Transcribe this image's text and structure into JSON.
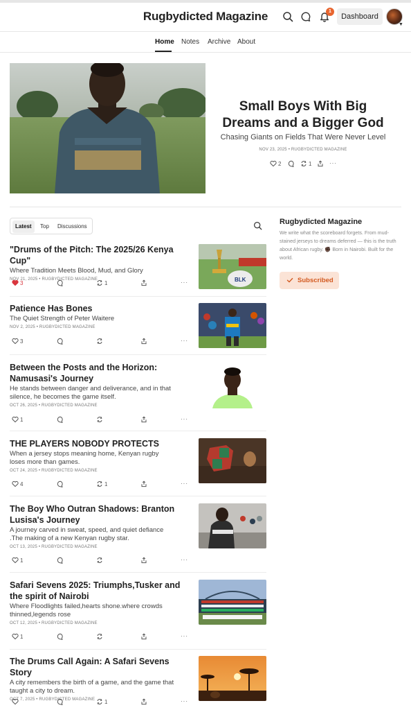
{
  "header": {
    "brand": "Rugbydicted Magazine",
    "notification_count": "1",
    "dashboard_label": "Dashboard",
    "icons": [
      "search-icon",
      "chat-icon",
      "bell-icon",
      "avatar",
      "chevron-down-icon"
    ]
  },
  "nav": {
    "items": [
      {
        "label": "Home",
        "active": true
      },
      {
        "label": "Notes",
        "active": false
      },
      {
        "label": "Archive",
        "active": false
      },
      {
        "label": "About",
        "active": false
      }
    ]
  },
  "hero": {
    "title": "Small Boys With Big Dreams and a Bigger God",
    "subtitle": "Chasing Giants on Fields That Were Never Level",
    "meta": "NOV 23, 2025 • RUGBYDICTED MAGAZINE",
    "likes": "2",
    "restacks": "1"
  },
  "feed": {
    "tabs": [
      {
        "label": "Latest",
        "active": true
      },
      {
        "label": "Top",
        "active": false
      },
      {
        "label": "Discussions",
        "active": false
      }
    ],
    "posts": [
      {
        "title": "\"Drums of the Pitch: The 2025/26 Kenya Cup\"",
        "subtitle": "Where Tradition Meets Blood, Mud, and Glory",
        "meta": "NOV 21, 2025 • RUGBYDICTED MAGAZINE",
        "likes": "3",
        "restacks": "1",
        "liked": true
      },
      {
        "title": "Patience Has Bones",
        "subtitle": "The Quiet Strength of Peter Waitere",
        "meta": "NOV 2, 2025 • RUGBYDICTED MAGAZINE",
        "likes": "3",
        "restacks": "",
        "liked": false
      },
      {
        "title": "Between the Posts and the Horizon: Namusasi's Journey",
        "subtitle": "He stands between danger and deliverance, and in that silence, he becomes the game itself.",
        "meta": "OCT 26, 2025 • RUGBYDICTED MAGAZINE",
        "likes": "1",
        "restacks": "",
        "liked": false
      },
      {
        "title": "THE PLAYERS NOBODY PROTECTS",
        "subtitle": "When a jersey stops meaning home, Kenyan rugby loses more than games.",
        "meta": "OCT 24, 2025 • RUGBYDICTED MAGAZINE",
        "likes": "4",
        "restacks": "1",
        "liked": false
      },
      {
        "title": "The Boy Who Outran Shadows: Branton Lusisa's Journey",
        "subtitle": "A journey carved in sweat, speed, and quiet defiance .The making of a new Kenyan rugby star.",
        "meta": "OCT 13, 2025 • RUGBYDICTED MAGAZINE",
        "likes": "1",
        "restacks": "",
        "liked": false
      },
      {
        "title": "Safari Sevens 2025: Triumphs,Tusker and the spirit of Nairobi",
        "subtitle": "Where Floodlights failed,hearts shone.where crowds thinned,legends rose",
        "meta": "OCT 12, 2025 • RUGBYDICTED MAGAZINE",
        "likes": "1",
        "restacks": "",
        "liked": false
      },
      {
        "title": "The Drums Call Again: A Safari Sevens Story",
        "subtitle": "A city remembers the birth of a game, and the game that taught a city to dream.",
        "meta": "OCT 7, 2025 • RUGBYDICTED MAGAZINE",
        "likes": "",
        "restacks": "1",
        "liked": false
      }
    ]
  },
  "sidebar": {
    "title": "Rugbydicted Magazine",
    "description": "We write what the scoreboard forgets. From mud-stained jerseys to dreams deferred — this is the truth about African rugby. ✊🏿 Born in Nairobi. Built for the world.",
    "subscribed_label": "Subscribed"
  },
  "colors": {
    "accent": "#e8652f",
    "subscribed_bg": "#fbe3d6",
    "liked_heart": "#d9363e"
  }
}
